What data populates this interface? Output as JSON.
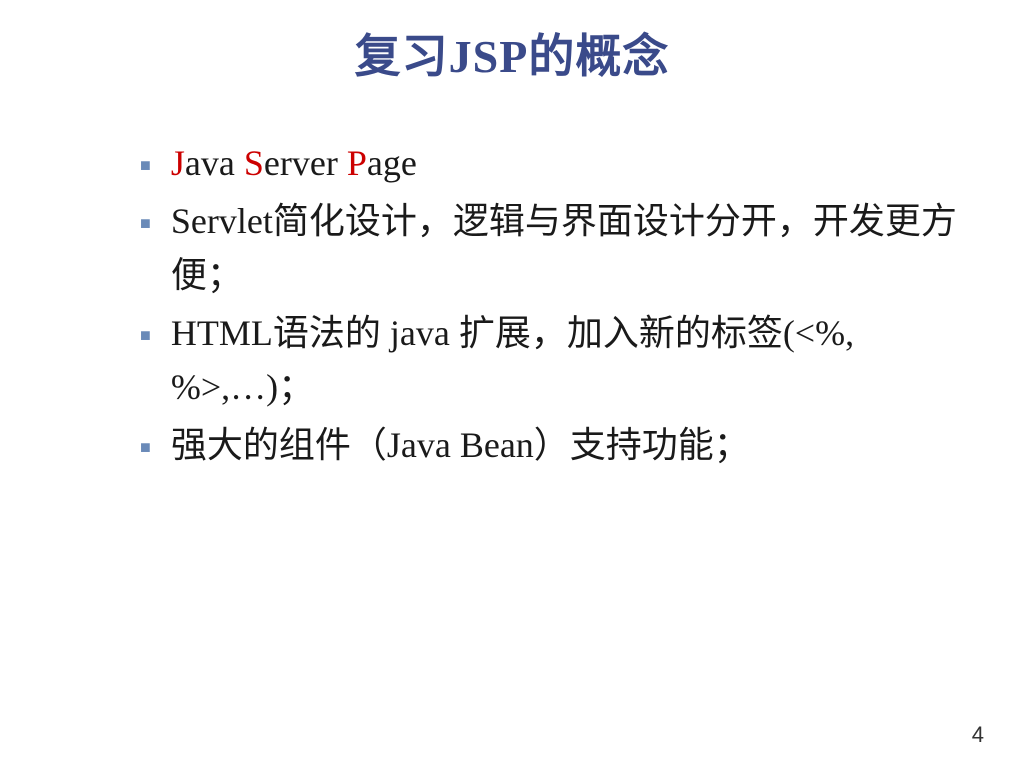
{
  "title": "复习JSP的概念",
  "bullets": {
    "item0": {
      "j": "J",
      "ava": "ava ",
      "s": "S",
      "erver": "erver ",
      "p": "P",
      "age": "age"
    },
    "item1": "Servlet简化设计，逻辑与界面设计分开，开发更方便；",
    "item2": "HTML语法的 java 扩展，加入新的标签(<%, %>,…)；",
    "item3": "强大的组件（Java Bean）支持功能；"
  },
  "pageNumber": "4"
}
